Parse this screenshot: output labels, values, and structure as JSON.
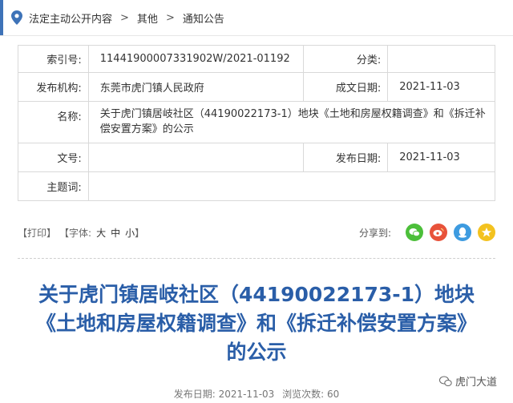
{
  "breadcrumb": {
    "items": [
      "法定主动公开内容",
      "其他",
      "通知公告"
    ],
    "separator": ">"
  },
  "meta": {
    "index_label": "索引号:",
    "index_value": "11441900007331902W/2021-01192",
    "category_label": "分类:",
    "category_value": "",
    "publisher_label": "发布机构:",
    "publisher_value": "东莞市虎门镇人民政府",
    "written_date_label": "成文日期:",
    "written_date_value": "2021-11-03",
    "name_label": "名称:",
    "name_value": "关于虎门镇居岐社区（44190022173-1）地块《土地和房屋权籍调查》和《拆迁补偿安置方案》的公示",
    "docno_label": "文号:",
    "docno_value": "",
    "pub_date_label": "发布日期:",
    "pub_date_value": "2021-11-03",
    "subject_label": "主题词:",
    "subject_value": ""
  },
  "tools": {
    "print_label": "【打印】",
    "font_label": "【字体:",
    "size_large": "大",
    "size_medium": "中",
    "size_small": "小",
    "font_close": "】",
    "share_label": "分享到:"
  },
  "article": {
    "title_line1": "关于虎门镇居岐社区（44190022173-1）地块",
    "title_line2": "《土地和房屋权籍调查》和《拆迁补偿安置方案》",
    "title_line3": "的公示",
    "pub_date_label": "发布日期:",
    "pub_date_value": "2021-11-03",
    "views_label": "浏览次数:",
    "views_value": "60"
  },
  "watermark": {
    "text": "虎门大道"
  },
  "colors": {
    "accent": "#3e73b8",
    "title": "#2a5ea8",
    "wechat": "#4cbf3a",
    "weibo": "#e8523a",
    "qq": "#3d9be0",
    "qzone": "#f3c21f"
  },
  "icons": [
    "location-pin-icon",
    "wechat-icon",
    "weibo-icon",
    "qq-icon",
    "qzone-icon",
    "wechat-watermark-icon"
  ]
}
